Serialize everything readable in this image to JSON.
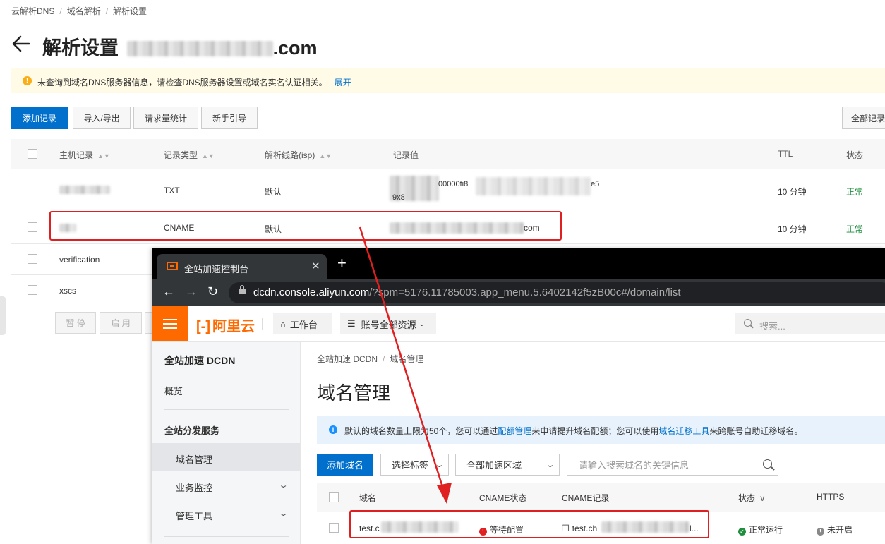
{
  "dns": {
    "breadcrumb": [
      "云解析DNS",
      "域名解析",
      "解析设置"
    ],
    "title_prefix": "解析设置",
    "title_suffix": ".com",
    "notice": {
      "text": "未查询到域名DNS服务器信息，请检查DNS服务器设置或域名实名认证相关。",
      "more": "展开"
    },
    "toolbar": {
      "add": "添加记录",
      "import_export": "导入/导出",
      "stats": "请求量统计",
      "guide": "新手引导",
      "all_records": "全部记录"
    },
    "columns": {
      "host": "主机记录",
      "type": "记录类型",
      "line": "解析线路(isp)",
      "value": "记录值",
      "ttl": "TTL",
      "status": "状态"
    },
    "rows": [
      {
        "host": "",
        "type": "TXT",
        "line": "默认",
        "value": "00000ti8",
        "value_tail": "e5",
        "value_line2": "9x8",
        "ttl": "10 分钟",
        "status": "正常"
      },
      {
        "host": "",
        "type": "CNAME",
        "line": "默认",
        "value": "com",
        "ttl": "10 分钟",
        "status": "正常"
      },
      {
        "host": "verification"
      },
      {
        "host": "xscs"
      }
    ],
    "bulk": {
      "pause": "暂 停",
      "enable": "启 用"
    }
  },
  "browser": {
    "tab_title": "全站加速控制台",
    "url_host": "dcdn.console.aliyun.com",
    "url_rest": "/?spm=5176.11785003.app_menu.5.6402142f5zB00c#/domain/list",
    "brand": "阿里云",
    "workbench": "工作台",
    "account": "账号全部资源",
    "search_placeholder": "搜索..."
  },
  "dcdn": {
    "sidebar": {
      "title": "全站加速 DCDN",
      "overview": "概览",
      "section": "全站分发服务",
      "domain_mgmt": "域名管理",
      "monitor": "业务监控",
      "tools": "管理工具"
    },
    "breadcrumb": [
      "全站加速 DCDN",
      "域名管理"
    ],
    "title": "域名管理",
    "info": {
      "p1": "默认的域名数量上限为50个，您可以通过",
      "link1": "配额管理",
      "p2": "来申请提升域名配额；您可以使用",
      "link2": "域名迁移工具",
      "p3": "来跨账号自助迁移域名。"
    },
    "add_button": "添加域名",
    "tag_select": "选择标签",
    "region_select": "全部加速区域",
    "search_placeholder": "请输入搜索域名的关键信息",
    "columns": {
      "domain": "域名",
      "cname_status": "CNAME状态",
      "cname": "CNAME记录",
      "status": "状态",
      "https": "HTTPS"
    },
    "row": {
      "domain": "test.c",
      "cname_status": "等待配置",
      "cname": "test.ch",
      "cname_tail": "l...",
      "status": "正常运行",
      "https": "未开启"
    }
  },
  "colors": {
    "accent": "#0070cc",
    "brand": "#ff6a00",
    "highlight": "#e02020",
    "ok": "#1e8e3e"
  }
}
